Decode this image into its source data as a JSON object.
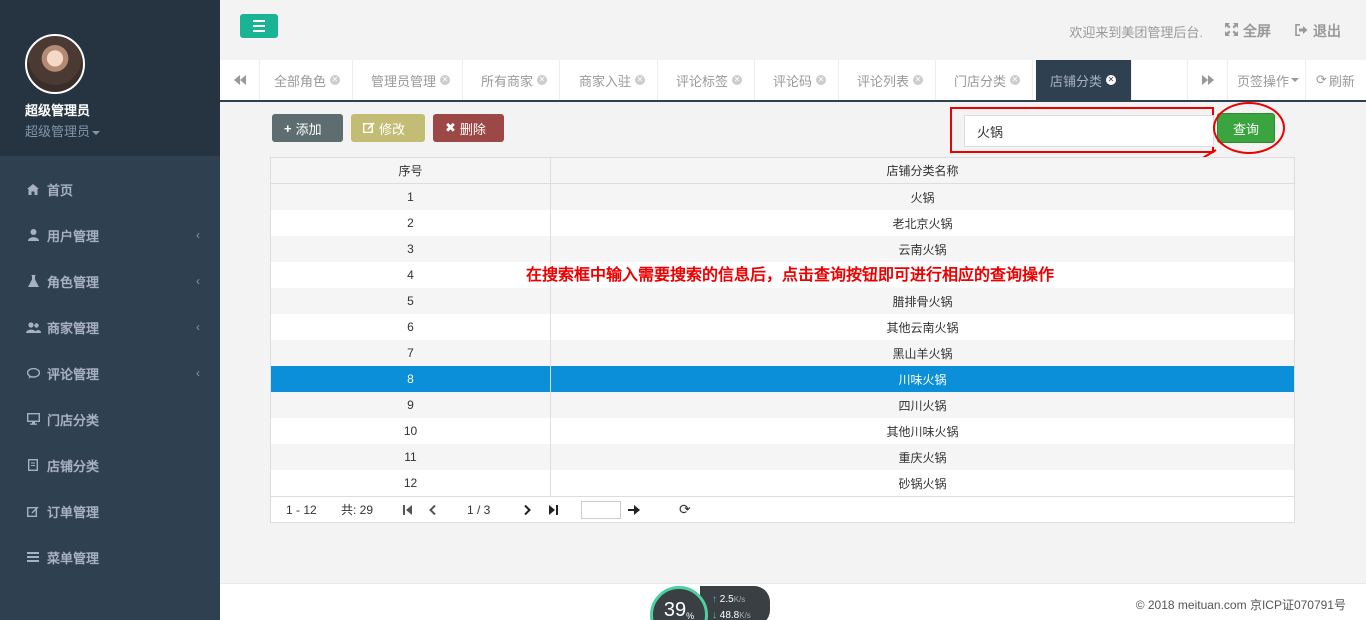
{
  "sidebar": {
    "profile": {
      "name": "超级管理员",
      "role": "超级管理员"
    },
    "items": [
      {
        "label": "首页",
        "icon": "home-icon"
      },
      {
        "label": "用户管理",
        "icon": "user-icon"
      },
      {
        "label": "角色管理",
        "icon": "flask-icon"
      },
      {
        "label": "商家管理",
        "icon": "users-icon"
      },
      {
        "label": "评论管理",
        "icon": "comment-icon"
      },
      {
        "label": "门店分类",
        "icon": "desktop-icon"
      },
      {
        "label": "店铺分类",
        "icon": "book-icon"
      },
      {
        "label": "订单管理",
        "icon": "edit-icon"
      },
      {
        "label": "菜单管理",
        "icon": "bars-icon"
      }
    ]
  },
  "header": {
    "welcome": "欢迎来到美团管理后台.",
    "fullscreen": "全屏",
    "logout": "退出"
  },
  "tabs": {
    "items": [
      "全部角色",
      "管理员管理",
      "所有商家",
      "商家入驻",
      "评论标签",
      "评论码",
      "评论列表",
      "门店分类",
      "店铺分类"
    ],
    "active": "店铺分类",
    "page_ops": "页签操作",
    "refresh": "刷新"
  },
  "toolbar": {
    "add": "添加",
    "edit": "修改",
    "delete": "删除"
  },
  "search": {
    "value": "火锅",
    "button": "查询"
  },
  "annotation": "在搜索框中输入需要搜索的信息后，点击查询按钮即可进行相应的查询操作",
  "table": {
    "columns": [
      "序号",
      "店铺分类名称"
    ],
    "rows": [
      [
        "1",
        "火锅"
      ],
      [
        "2",
        "老北京火锅"
      ],
      [
        "3",
        "云南火锅"
      ],
      [
        "4",
        ""
      ],
      [
        "5",
        "腊排骨火锅"
      ],
      [
        "6",
        "其他云南火锅"
      ],
      [
        "7",
        "黑山羊火锅"
      ],
      [
        "8",
        "川味火锅"
      ],
      [
        "9",
        "四川火锅"
      ],
      [
        "10",
        "其他川味火锅"
      ],
      [
        "11",
        "重庆火锅"
      ],
      [
        "12",
        "砂锅火锅"
      ]
    ],
    "selected_row": 8
  },
  "pager": {
    "range": "1 - 12",
    "total": "共: 29",
    "page": "1 / 3"
  },
  "footer": {
    "copyright": "© 2018 meituan.com 京ICP证070791号",
    "speed": {
      "percent": "39",
      "unit": "%",
      "up": "2.5",
      "down": "48.8",
      "rate_unit": "K/s"
    }
  },
  "colors": {
    "accent": "#1ab394",
    "sidebar": "#2f4050",
    "selected": "#0a8fd8",
    "annotation": "#e00000"
  }
}
